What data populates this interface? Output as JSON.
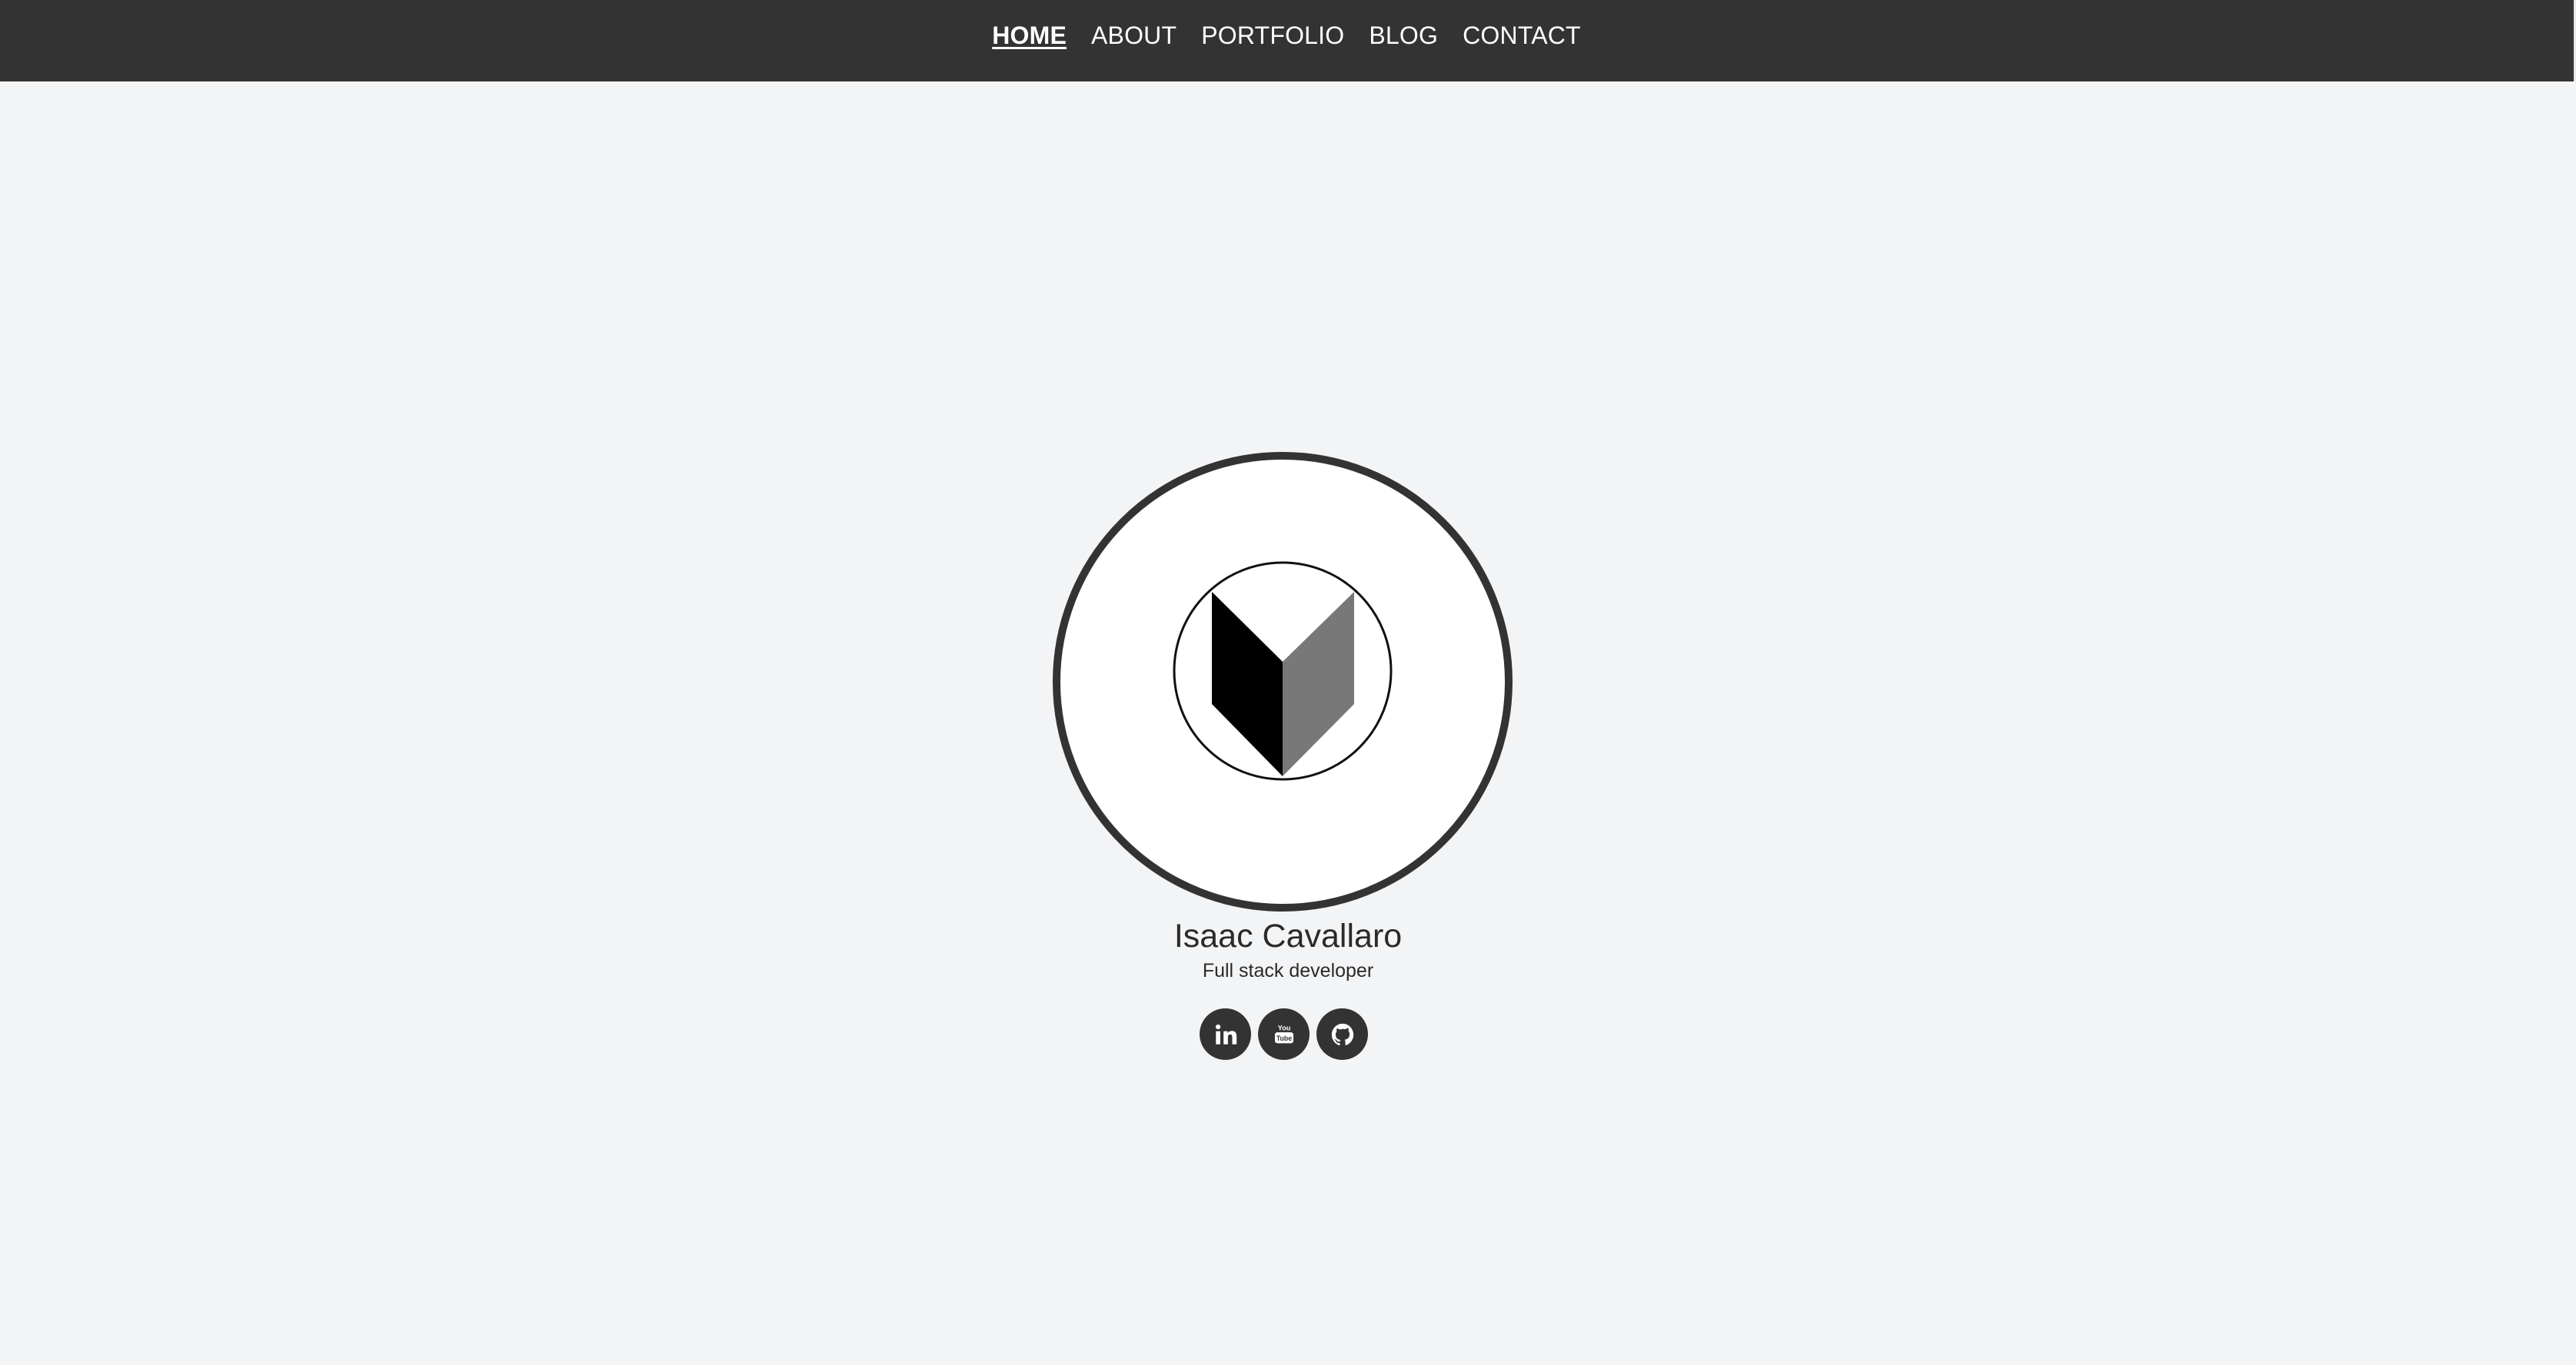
{
  "nav": {
    "items": [
      {
        "label": "HOME",
        "active": true
      },
      {
        "label": "ABOUT",
        "active": false
      },
      {
        "label": "PORTFOLIO",
        "active": false
      },
      {
        "label": "BLOG",
        "active": false
      },
      {
        "label": "CONTACT",
        "active": false
      }
    ]
  },
  "profile": {
    "name": "Isaac Cavallaro",
    "role": "Full stack developer",
    "logo_icon": "geometric-v-logo-icon"
  },
  "social": [
    {
      "icon": "linkedin-icon"
    },
    {
      "icon": "youtube-icon"
    },
    {
      "icon": "github-icon"
    }
  ],
  "colors": {
    "nav_background": "#333333",
    "page_background": "#f3f4f6",
    "avatar_border": "#333333",
    "logo_dark": "#000000",
    "logo_gray": "#787878"
  }
}
